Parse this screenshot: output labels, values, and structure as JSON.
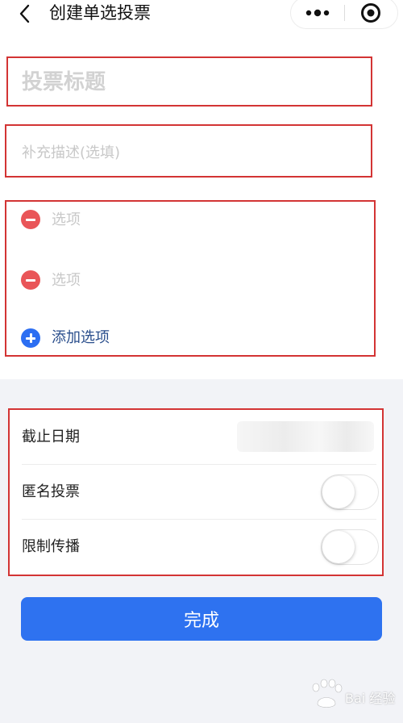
{
  "header": {
    "title": "创建单选投票",
    "back_icon": "chevron-left-icon",
    "more_icon": "more-dots-icon",
    "close_icon": "target-circle-icon"
  },
  "form": {
    "title_placeholder": "投票标题",
    "description_placeholder": "补充描述(选填)",
    "options": [
      {
        "placeholder": "选项"
      },
      {
        "placeholder": "选项"
      }
    ],
    "add_option_label": "添加选项"
  },
  "settings": {
    "deadline_label": "截止日期",
    "anonymous_label": "匿名投票",
    "anonymous_enabled": false,
    "restrict_sharing_label": "限制传播",
    "restrict_sharing_enabled": false
  },
  "actions": {
    "done_label": "完成"
  },
  "watermark": {
    "text": "Bai 经验"
  },
  "colors": {
    "primary_button": "#2e72f0",
    "remove_icon": "#e95558",
    "add_icon": "#2c6ef2",
    "add_label": "#2a4e8c",
    "annotation_border": "#d33434",
    "page_background": "#f2f3f7"
  }
}
